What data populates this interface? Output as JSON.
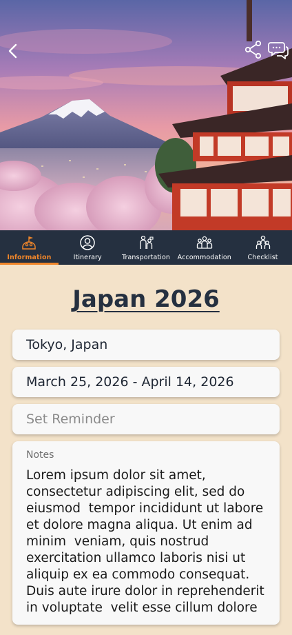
{
  "header": {
    "icons": {
      "back": "chevron-left-icon",
      "share": "share-icon",
      "chat": "chat-bubbles-icon"
    }
  },
  "tabs": [
    {
      "label": "Information",
      "icon": "explorer-icon",
      "active": true
    },
    {
      "label": "Itinerary",
      "icon": "person-circle-icon",
      "active": false
    },
    {
      "label": "Transportation",
      "icon": "travel-people-icon",
      "active": false
    },
    {
      "label": "Accommodation",
      "icon": "group-icon",
      "active": false
    },
    {
      "label": "Checklist",
      "icon": "team-icon",
      "active": false
    }
  ],
  "trip": {
    "title": "Japan 2026",
    "location": "Tokyo, Japan",
    "dates": "March 25, 2026 - April 14, 2026",
    "reminder_placeholder": "Set Reminder",
    "notes_label": "Notes",
    "notes_text": "Lorem ipsum dolor sit amet, consectetur adipiscing elit, sed do eiusmod  tempor incididunt ut labore et dolore magna aliqua. Ut enim ad minim  veniam, quis nostrud exercitation ullamco laboris nisi ut aliquip ex ea commodo consequat. Duis aute irure dolor in reprehenderit in voluptate  velit esse cillum dolore"
  },
  "colors": {
    "accent": "#f0862a",
    "tabbar": "#253040",
    "background": "#f3e2c9",
    "card": "#f8f8f8"
  }
}
